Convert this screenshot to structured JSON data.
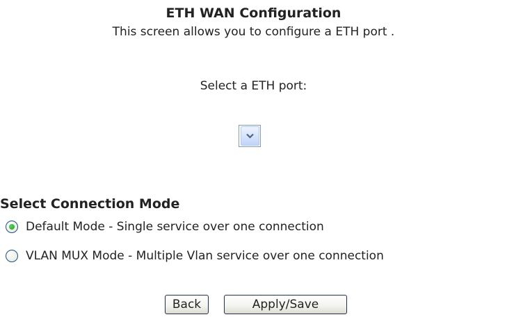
{
  "header": {
    "title": "ETH WAN Configuration",
    "subtitle": "This screen allows you to configure a ETH port ."
  },
  "port": {
    "label": "Select a ETH port:",
    "selected_value": ""
  },
  "connection_mode": {
    "heading": "Select Connection Mode",
    "options": [
      {
        "label": "Default Mode - Single service over one connection",
        "checked": true
      },
      {
        "label": "VLAN MUX Mode - Multiple Vlan service over one connection",
        "checked": false
      }
    ]
  },
  "actions": {
    "back_label": "Back",
    "apply_label": "Apply/Save"
  }
}
